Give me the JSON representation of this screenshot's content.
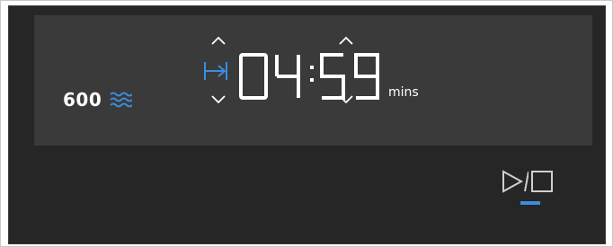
{
  "power": {
    "value": "600",
    "icon": "microwave-wave-icon"
  },
  "timer": {
    "display": [
      "0",
      "4",
      "5",
      "9"
    ],
    "units": "mins",
    "mode_icon": "end-time-icon"
  },
  "controls": {
    "play_stop_icon": "play-stop-icon"
  },
  "colors": {
    "accent": "#3a8de0",
    "panel": "#262626",
    "display": "#3a3a3a",
    "text": "#ffffff"
  }
}
